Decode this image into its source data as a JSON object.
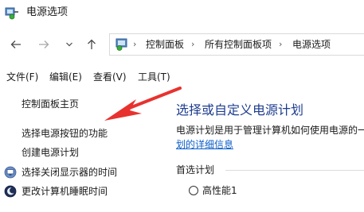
{
  "window": {
    "title": "电源选项"
  },
  "nav": {
    "back": "←",
    "forward": "→",
    "dropdown": "∨",
    "up": "↑"
  },
  "address": {
    "crumbs": [
      "控制面板",
      "所有控制面板项",
      "电源选项"
    ],
    "separator": "›"
  },
  "menu": {
    "items": [
      "文件(F)",
      "编辑(E)",
      "查看(V)",
      "工具(T)"
    ]
  },
  "sidebar": {
    "items": [
      {
        "label": "控制面板主页",
        "icon": ""
      },
      {
        "label": "选择电源按钮的功能",
        "icon": ""
      },
      {
        "label": "创建电源计划",
        "icon": ""
      },
      {
        "label": "选择关闭显示器的时间",
        "icon": "monitor-icon"
      },
      {
        "label": "更改计算机睡眠时间",
        "icon": "moon-icon"
      }
    ]
  },
  "main": {
    "heading": "选择或自定义电源计划",
    "description": "电源计划是用于管理计算机如何使用电源的一",
    "more_link": "划的详细信息",
    "group_label": "首选计划",
    "plans": [
      {
        "label": "高性能1",
        "selected": false
      }
    ]
  },
  "colors": {
    "heading": "#1e3d8f",
    "link": "#0b5ec8",
    "annotation_arrow": "#e8322f"
  }
}
